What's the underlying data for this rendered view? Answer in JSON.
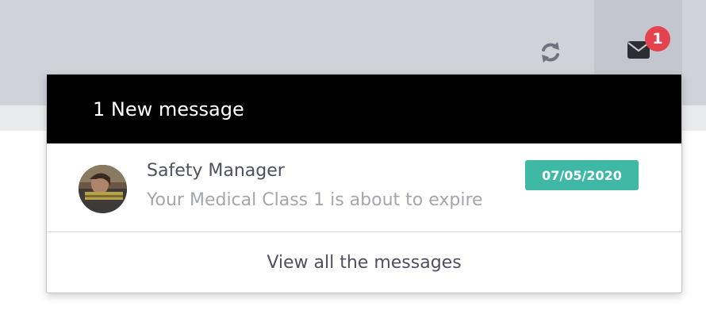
{
  "colors": {
    "topbar": "#cfd2d9",
    "mail_button": "#c3c6ce",
    "badge": "#e5424d",
    "header": "#000000",
    "date_badge": "#3fb8a6",
    "primary_text": "#4e5060",
    "muted_text": "#a3a6ad"
  },
  "topbar": {
    "refresh_icon": "refresh-icon",
    "mail_icon": "envelope-icon",
    "unread_count": "1"
  },
  "dropdown": {
    "header": "1 New message",
    "messages": [
      {
        "avatar_icon": "user-avatar",
        "sender": "Safety Manager",
        "preview": "Your Medical Class 1 is about to expire",
        "date": "07/05/2020"
      }
    ],
    "view_all_label": "View all the messages"
  }
}
